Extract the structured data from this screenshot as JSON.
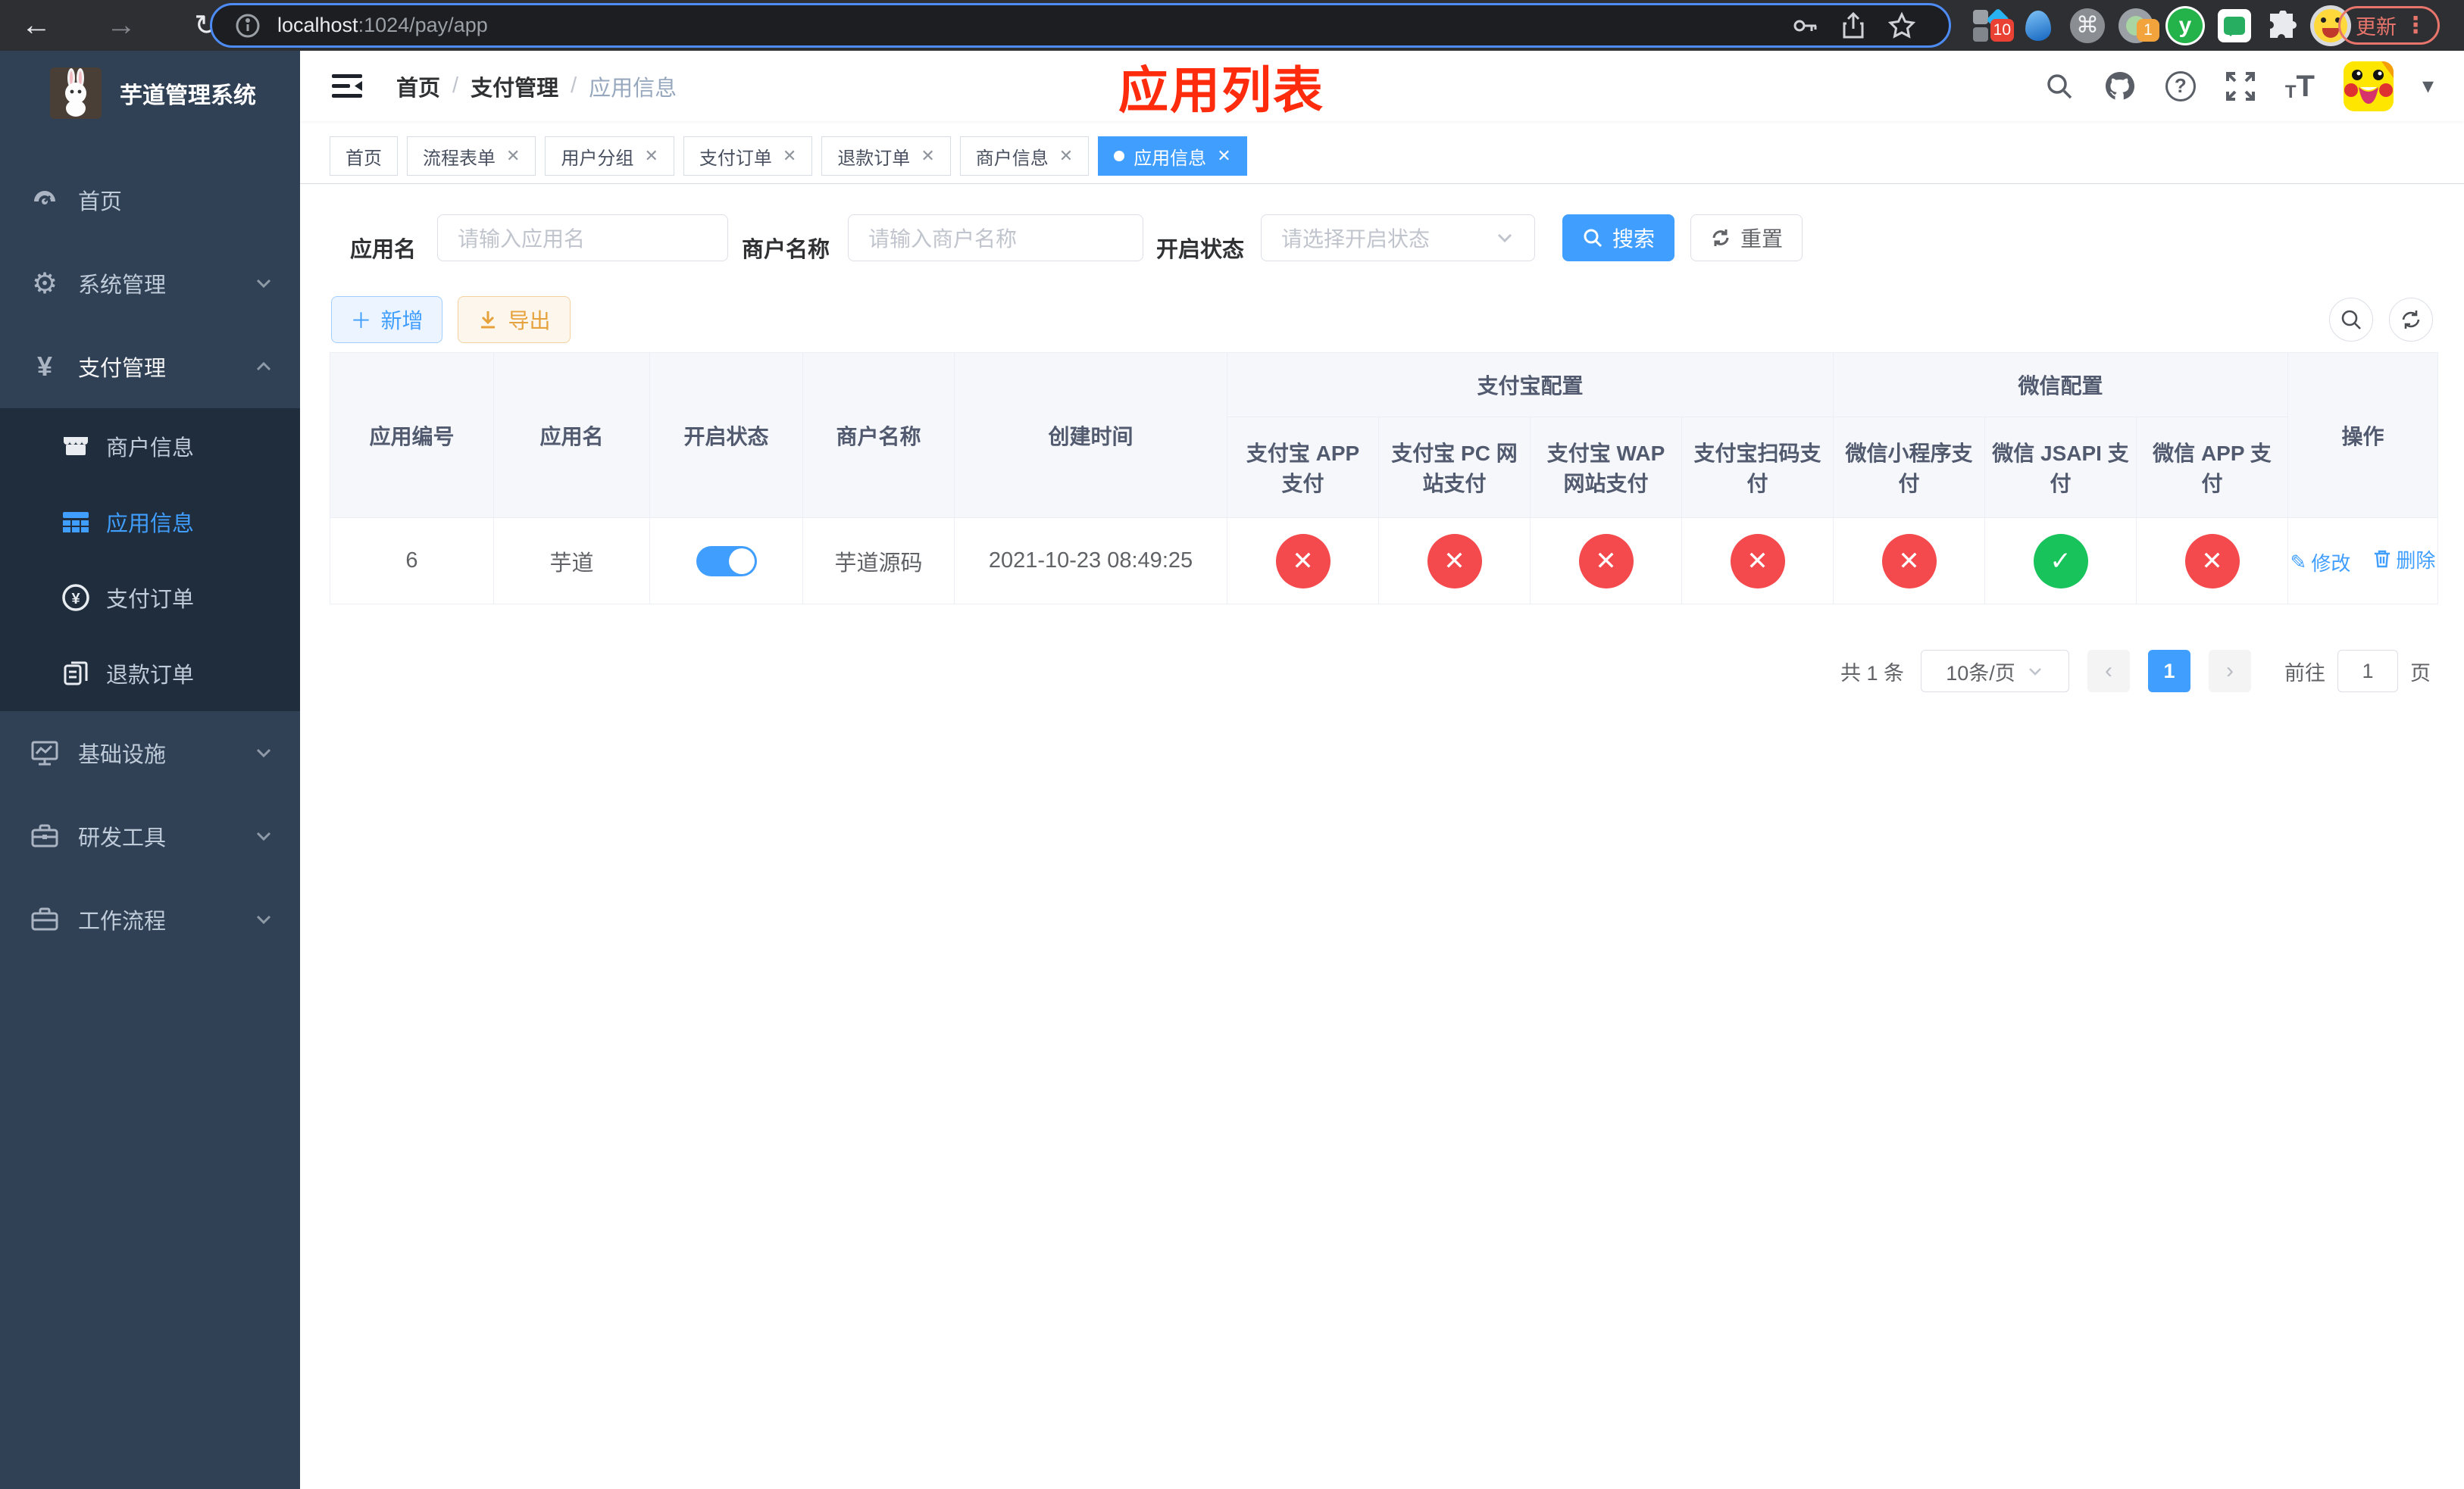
{
  "browser": {
    "url_host": "localhost",
    "url_rest": ":1024/pay/app",
    "update_label": "更新",
    "ext_badge_sketch": "10",
    "ext_badge_session": "1",
    "ext_y_label": "y"
  },
  "sidebar": {
    "title": "芋道管理系统",
    "items": {
      "home": "首页",
      "system": "系统管理",
      "pay": "支付管理",
      "merchant": "商户信息",
      "appinfo": "应用信息",
      "payorder": "支付订单",
      "refund": "退款订单",
      "infra": "基础设施",
      "devtool": "研发工具",
      "workflow": "工作流程"
    }
  },
  "header": {
    "breadcrumb": [
      "首页",
      "支付管理",
      "应用信息"
    ],
    "annotation": "应用列表"
  },
  "tabs": {
    "home": "首页",
    "flow": "流程表单",
    "group": "用户分组",
    "payorder": "支付订单",
    "refund": "退款订单",
    "merchant": "商户信息",
    "appinfo": "应用信息"
  },
  "filters": {
    "app_name_label": "应用名",
    "app_name_placeholder": "请输入应用名",
    "merchant_label": "商户名称",
    "merchant_placeholder": "请输入商户名称",
    "status_label": "开启状态",
    "status_placeholder": "请选择开启状态",
    "search_label": "搜索",
    "reset_label": "重置"
  },
  "toolbar": {
    "add_label": "新增",
    "export_label": "导出"
  },
  "table": {
    "group_headers": {
      "alipay": "支付宝配置",
      "wechat": "微信配置",
      "actions": "操作"
    },
    "columns": [
      "应用编号",
      "应用名",
      "开启状态",
      "商户名称",
      "创建时间",
      "支付宝 APP 支付",
      "支付宝 PC 网站支付",
      "支付宝 WAP 网站支付",
      "支付宝扫码支付",
      "微信小程序支付",
      "微信 JSAPI 支付",
      "微信 APP 支付"
    ],
    "rows": [
      {
        "id": "6",
        "name": "芋道",
        "enabled": true,
        "merchant": "芋道源码",
        "created_at": "2021-10-23 08:49:25",
        "pay_status": [
          false,
          false,
          false,
          false,
          false,
          true,
          false
        ],
        "edit_label": "修改",
        "delete_label": "删除"
      }
    ]
  },
  "pagination": {
    "total_label": "共 1 条",
    "page_size": "10条/页",
    "current_page": "1",
    "goto_label": "前往",
    "goto_value": "1",
    "goto_suffix": "页"
  },
  "icons": {
    "close": "✕",
    "check": "✓",
    "plus": "＋",
    "yuan": "¥",
    "dots": "⋮",
    "caret": "▾",
    "gear": "⚙",
    "question": "?",
    "back": "←",
    "forward": "→",
    "reload": "↻",
    "prev": "‹",
    "next": "›",
    "edit": "✎",
    "font_small": "T",
    "font_large": "T",
    "y_pay": "¥"
  },
  "colors": {
    "primary": "#409eff",
    "success": "#19c35c",
    "danger": "#f4494d",
    "warning_text": "#e6a23c",
    "sidebar_bg": "#304156",
    "submenu_bg": "#1f2d3d",
    "annotation_red": "#fe2b0c",
    "chrome_bg": "#2e2f33",
    "update_red": "#e8756b"
  }
}
